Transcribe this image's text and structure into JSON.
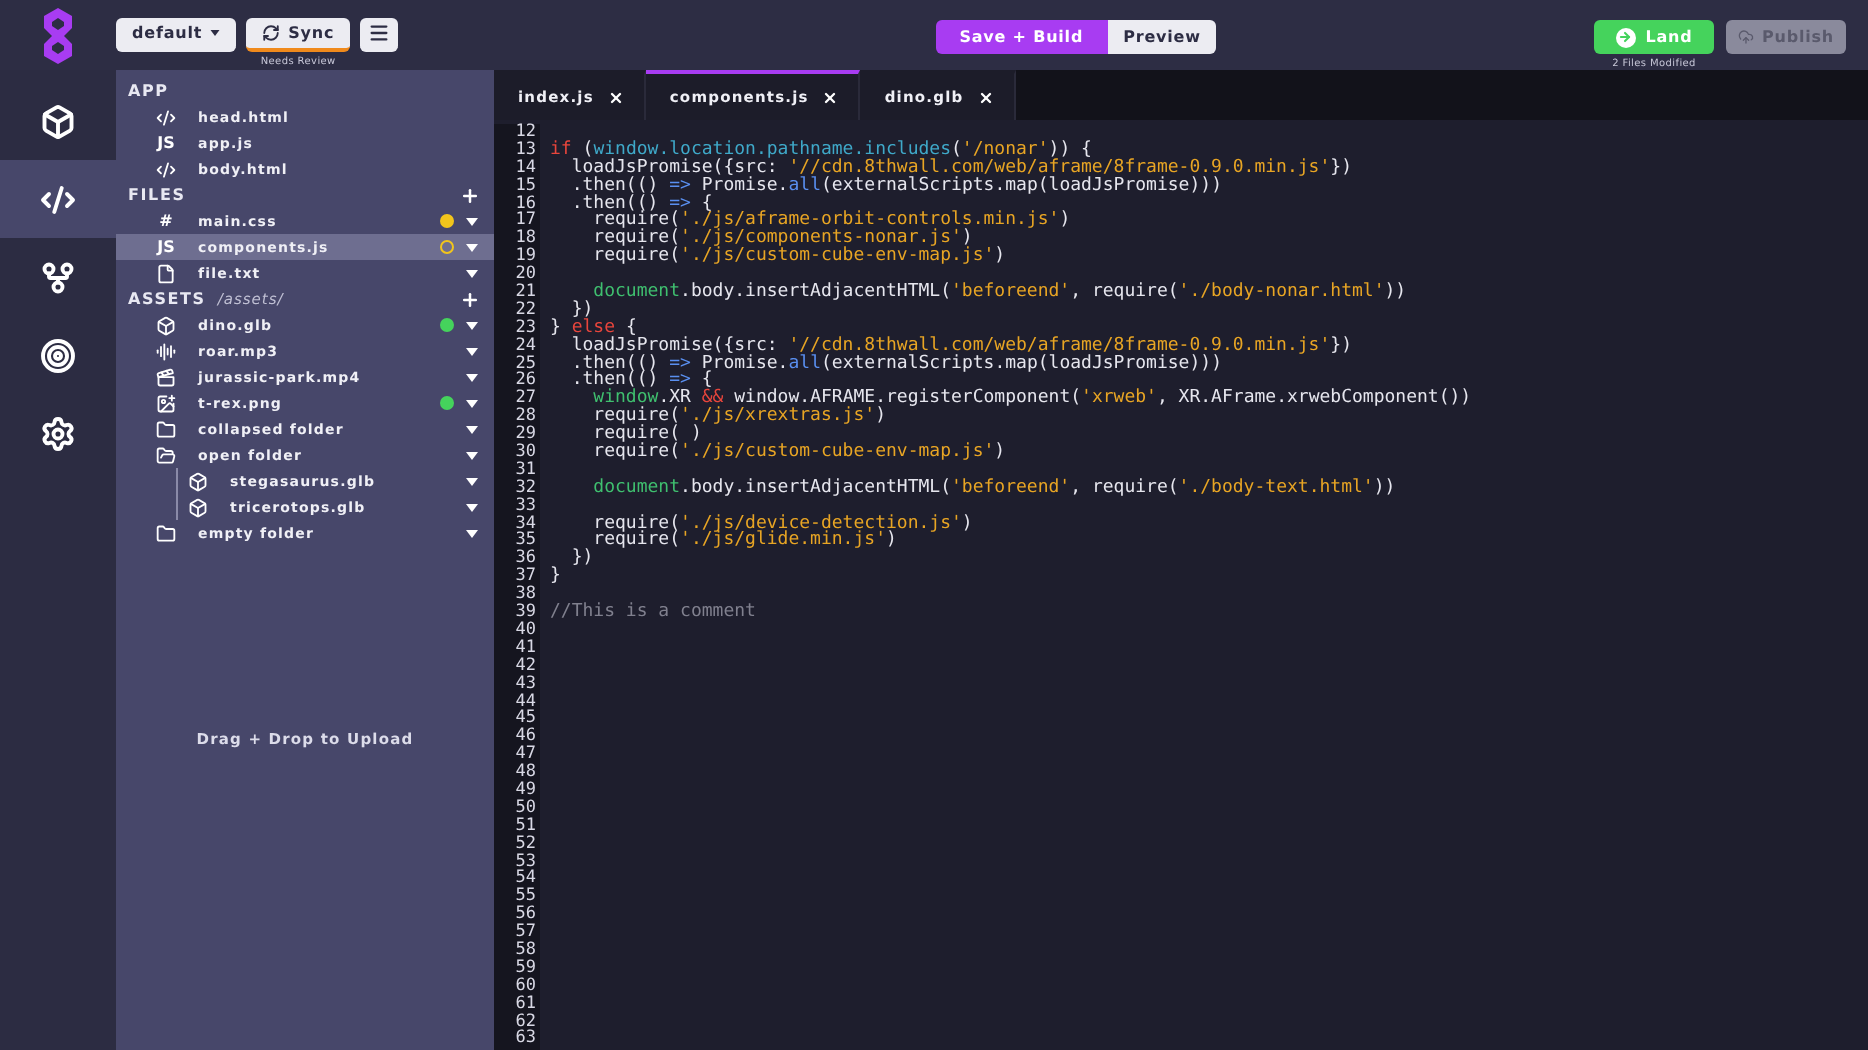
{
  "toolbar": {
    "branch_dropdown": {
      "value": "default"
    },
    "sync_button": {
      "label": "Sync",
      "warning": true,
      "caption": "Needs Review"
    },
    "build_button": {
      "label": "Save + Build"
    },
    "preview_button": {
      "label": "Preview"
    },
    "land_button": {
      "label": "Land",
      "caption": "2 Files Modified"
    },
    "publish_button": {
      "label": "Publish",
      "disabled": true
    }
  },
  "rail": [
    {
      "kind": "cube",
      "selected": false
    },
    {
      "kind": "code",
      "selected": true
    },
    {
      "kind": "branch",
      "selected": false
    },
    {
      "kind": "target",
      "selected": false
    },
    {
      "kind": "gear",
      "selected": false
    }
  ],
  "sidebar": {
    "sections": [
      {
        "title": "APP",
        "addable": false,
        "items": [
          {
            "name": "head.html",
            "kind": "code",
            "selected": false
          },
          {
            "name": "app.js",
            "kind": "glyph",
            "glyph": "JS",
            "selected": false
          },
          {
            "name": "body.html",
            "kind": "code",
            "selected": false
          }
        ]
      },
      {
        "title": "FILES",
        "addable": true,
        "items": [
          {
            "name": "main.css",
            "kind": "glyph",
            "glyph": "#",
            "selected": false,
            "menu": true,
            "dot": {
              "color": "#f2c51c",
              "filled": true
            }
          },
          {
            "name": "components.js",
            "kind": "glyph",
            "glyph": "JS",
            "selected": true,
            "menu": true,
            "dot": {
              "color": "#f2c51c",
              "filled": false
            }
          },
          {
            "name": "file.txt",
            "kind": "file",
            "selected": false,
            "menu": true
          }
        ]
      },
      {
        "title": "ASSETS",
        "path": "/assets/",
        "addable": true,
        "items": [
          {
            "name": "dino.glb",
            "kind": "model",
            "selected": false,
            "menu": true,
            "dot": {
              "color": "#45d35c",
              "filled": true
            }
          },
          {
            "name": "roar.mp3",
            "kind": "audio",
            "selected": false,
            "menu": true
          },
          {
            "name": "jurassic-park.mp4",
            "kind": "video",
            "selected": false,
            "menu": true
          },
          {
            "name": "t-rex.png",
            "kind": "image",
            "selected": false,
            "menu": true,
            "dot": {
              "color": "#45d35c",
              "filled": true
            }
          },
          {
            "name": "collapsed folder",
            "kind": "folder",
            "expanded": false,
            "selected": false,
            "menu": true
          },
          {
            "name": "open folder",
            "kind": "folder",
            "expanded": true,
            "selected": false,
            "menu": true,
            "children": [
              {
                "name": "stegasaurus.glb",
                "kind": "model",
                "selected": false,
                "menu": true
              },
              {
                "name": "tricerotops.glb",
                "kind": "model",
                "selected": false,
                "menu": true
              }
            ]
          },
          {
            "name": "empty folder",
            "kind": "folder",
            "expanded": false,
            "selected": false,
            "menu": true
          }
        ]
      }
    ],
    "drop_hint": "Drag + Drop to Upload"
  },
  "tabs": [
    {
      "label": "index.js",
      "selected": false
    },
    {
      "label": "components.js",
      "selected": true
    },
    {
      "label": "dino.glb",
      "selected": false
    }
  ],
  "editor": {
    "lines": [
      {
        "n": "12"
      },
      {
        "n": "13",
        "tokens": [
          {
            "kind": "kw",
            "text": "if"
          },
          {
            "kind": "plain",
            "text": " ("
          },
          {
            "kind": "prop",
            "text": "window.location.pathname.includes"
          },
          {
            "kind": "plain",
            "text": "("
          },
          {
            "kind": "str",
            "text": "'/nonar'"
          },
          {
            "kind": "plain",
            "text": ")) {"
          }
        ]
      },
      {
        "n": "14",
        "tokens": [
          {
            "kind": "plain",
            "text": "  loadJsPromise({src: "
          },
          {
            "kind": "str",
            "text": "'//cdn.8thwall.com/web/aframe/8frame-0.9.0.min.js'"
          },
          {
            "kind": "plain",
            "text": "})"
          }
        ]
      },
      {
        "n": "15",
        "tokens": [
          {
            "kind": "plain",
            "text": "  .then(() "
          },
          {
            "kind": "op",
            "text": "=>"
          },
          {
            "kind": "plain",
            "text": " Promise."
          },
          {
            "kind": "op",
            "text": "all"
          },
          {
            "kind": "plain",
            "text": "(externalScripts.map(loadJsPromise)))"
          }
        ]
      },
      {
        "n": "16",
        "tokens": [
          {
            "kind": "plain",
            "text": "  .then(() "
          },
          {
            "kind": "op",
            "text": "=>"
          },
          {
            "kind": "plain",
            "text": " {"
          }
        ]
      },
      {
        "n": "17",
        "tokens": [
          {
            "kind": "plain",
            "text": "    require("
          },
          {
            "kind": "str",
            "text": "'./js/aframe-orbit-controls.min.js'"
          },
          {
            "kind": "plain",
            "text": ")"
          }
        ]
      },
      {
        "n": "18",
        "tokens": [
          {
            "kind": "plain",
            "text": "    require("
          },
          {
            "kind": "str",
            "text": "'./js/components-nonar.js'"
          },
          {
            "kind": "plain",
            "text": ")"
          }
        ]
      },
      {
        "n": "19",
        "tokens": [
          {
            "kind": "plain",
            "text": "    require("
          },
          {
            "kind": "str",
            "text": "'./js/custom-cube-env-map.js'"
          },
          {
            "kind": "plain",
            "text": ")"
          }
        ]
      },
      {
        "n": "20"
      },
      {
        "n": "21",
        "tokens": [
          {
            "kind": "global",
            "text": "    document"
          },
          {
            "kind": "plain",
            "text": ".body.insertAdjacentHTML("
          },
          {
            "kind": "str",
            "text": "'beforeend'"
          },
          {
            "kind": "plain",
            "text": ", require("
          },
          {
            "kind": "str",
            "text": "'./body-nonar.html'"
          },
          {
            "kind": "plain",
            "text": "))"
          }
        ]
      },
      {
        "n": "22",
        "tokens": [
          {
            "kind": "plain",
            "text": "  })"
          }
        ]
      },
      {
        "n": "23",
        "tokens": [
          {
            "kind": "plain",
            "text": "} "
          },
          {
            "kind": "kw",
            "text": "else"
          },
          {
            "kind": "plain",
            "text": " {"
          }
        ]
      },
      {
        "n": "24",
        "tokens": [
          {
            "kind": "plain",
            "text": "  loadJsPromise({src: "
          },
          {
            "kind": "str",
            "text": "'//cdn.8thwall.com/web/aframe/8frame-0.9.0.min.js'"
          },
          {
            "kind": "plain",
            "text": "})"
          }
        ]
      },
      {
        "n": "25",
        "tokens": [
          {
            "kind": "plain",
            "text": "  .then(() "
          },
          {
            "kind": "op",
            "text": "=>"
          },
          {
            "kind": "plain",
            "text": " Promise."
          },
          {
            "kind": "op",
            "text": "all"
          },
          {
            "kind": "plain",
            "text": "(externalScripts.map(loadJsPromise)))"
          }
        ]
      },
      {
        "n": "26",
        "tokens": [
          {
            "kind": "plain",
            "text": "  .then(() "
          },
          {
            "kind": "op",
            "text": "=>"
          },
          {
            "kind": "plain",
            "text": " {"
          }
        ]
      },
      {
        "n": "27",
        "tokens": [
          {
            "kind": "global",
            "text": "    window"
          },
          {
            "kind": "plain",
            "text": ".XR "
          },
          {
            "kind": "kw",
            "text": "&&"
          },
          {
            "kind": "plain",
            "text": " window.AFRAME.registerComponent("
          },
          {
            "kind": "str",
            "text": "'xrweb'"
          },
          {
            "kind": "plain",
            "text": ", XR.AFrame.xrwebComponent())"
          }
        ]
      },
      {
        "n": "28",
        "tokens": [
          {
            "kind": "plain",
            "text": "    require("
          },
          {
            "kind": "str",
            "text": "'./js/xrextras.js'"
          },
          {
            "kind": "plain",
            "text": ")"
          }
        ]
      },
      {
        "n": "29",
        "tokens": [
          {
            "kind": "plain",
            "text": "    require( )"
          }
        ]
      },
      {
        "n": "30",
        "tokens": [
          {
            "kind": "plain",
            "text": "    require("
          },
          {
            "kind": "str",
            "text": "'./js/custom-cube-env-map.js'"
          },
          {
            "kind": "plain",
            "text": ")"
          }
        ]
      },
      {
        "n": "31"
      },
      {
        "n": "32",
        "tokens": [
          {
            "kind": "global",
            "text": "    document"
          },
          {
            "kind": "plain",
            "text": ".body.insertAdjacentHTML("
          },
          {
            "kind": "str",
            "text": "'beforeend'"
          },
          {
            "kind": "plain",
            "text": ", require("
          },
          {
            "kind": "str",
            "text": "'./body-text.html'"
          },
          {
            "kind": "plain",
            "text": "))"
          }
        ]
      },
      {
        "n": "33"
      },
      {
        "n": "34",
        "tokens": [
          {
            "kind": "plain",
            "text": "    require("
          },
          {
            "kind": "str",
            "text": "'./js/device-detection.js'"
          },
          {
            "kind": "plain",
            "text": ")"
          }
        ]
      },
      {
        "n": "35",
        "tokens": [
          {
            "kind": "plain",
            "text": "    require("
          },
          {
            "kind": "str",
            "text": "'./js/glide.min.js'"
          },
          {
            "kind": "plain",
            "text": ")"
          }
        ]
      },
      {
        "n": "36",
        "tokens": [
          {
            "kind": "plain",
            "text": "  })"
          }
        ]
      },
      {
        "n": "37",
        "tokens": [
          {
            "kind": "plain",
            "text": "}"
          }
        ]
      },
      {
        "n": "38"
      },
      {
        "n": "39",
        "tokens": [
          {
            "kind": "cmt",
            "text": "//This is a comment"
          }
        ]
      },
      {
        "n": "40"
      },
      {
        "n": "41"
      },
      {
        "n": "42"
      },
      {
        "n": "43"
      },
      {
        "n": "44"
      },
      {
        "n": "45"
      },
      {
        "n": "46"
      },
      {
        "n": "47"
      },
      {
        "n": "48"
      },
      {
        "n": "49"
      },
      {
        "n": "50"
      },
      {
        "n": "51"
      },
      {
        "n": "52"
      },
      {
        "n": "53"
      },
      {
        "n": "54"
      },
      {
        "n": "55"
      },
      {
        "n": "56"
      },
      {
        "n": "57"
      },
      {
        "n": "58"
      },
      {
        "n": "59"
      },
      {
        "n": "60"
      },
      {
        "n": "61"
      },
      {
        "n": "62"
      },
      {
        "n": "63"
      }
    ]
  }
}
